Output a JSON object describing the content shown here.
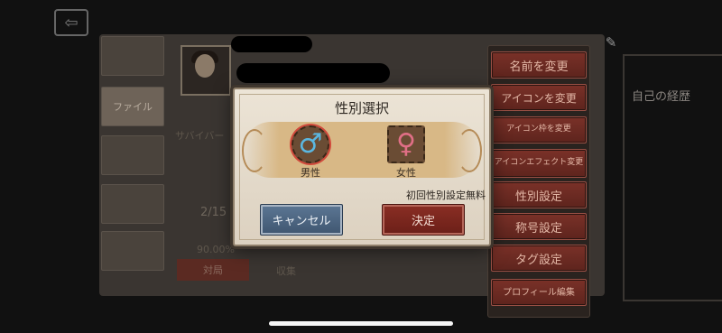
{
  "background": {
    "side_tabs": [
      "ファイル",
      "",
      "",
      "",
      ""
    ],
    "player_name_redacted": true,
    "survivor_label": "サバイバー",
    "stat_left": "2/15",
    "stat_pct": "90.00%",
    "bottom_buttons": [
      "対局",
      "収集"
    ]
  },
  "right_menu": {
    "items": [
      "名前を変更",
      "アイコンを変更",
      "アイコン枠を変更",
      "アイコンエフェクト変更",
      "性別設定",
      "称号設定",
      "タグ設定",
      "プロフィール編集"
    ]
  },
  "right_panel": {
    "title": "自己の経歴"
  },
  "modal": {
    "title": "性別選択",
    "male_label": "男性",
    "female_label": "女性",
    "male_symbol": "♂",
    "female_symbol": "♀",
    "free_note": "初回性別設定無料",
    "cancel_label": "キャンセル",
    "confirm_label": "決定",
    "selected": "male"
  },
  "icons": {
    "back": "door-exit-icon",
    "settings": "wrench-icon"
  },
  "colors": {
    "menu_red": "#6b281f",
    "cancel_blue": "#4d6683",
    "confirm_red": "#7a2720",
    "male_blue": "#5bb7e0",
    "female_pink": "#e06f86"
  }
}
